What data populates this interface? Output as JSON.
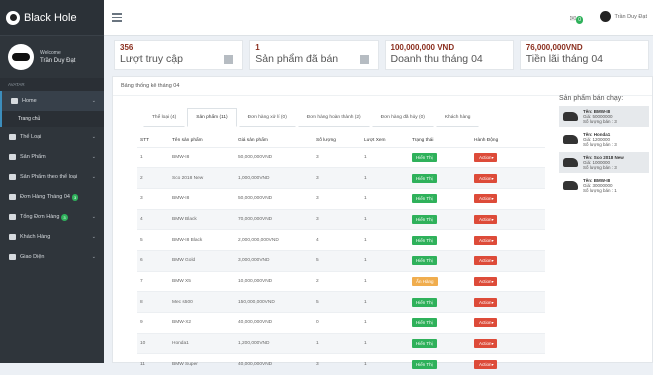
{
  "app": {
    "title": "Black Hole"
  },
  "profile": {
    "welcome": "Welcome",
    "name": "Trần Duy Đạt"
  },
  "sidebar": {
    "section": "AVATAR",
    "items": [
      {
        "label": "Home",
        "active": true
      },
      {
        "label": "Trang chủ",
        "sub": true
      },
      {
        "label": "Thể Loại"
      },
      {
        "label": "Sản Phẩm"
      },
      {
        "label": "Sản Phẩm theo thể loại"
      },
      {
        "label": "Đơn Hàng Tháng 04",
        "badge": "3"
      },
      {
        "label": "Tổng Đơn Hàng",
        "badge": "3"
      },
      {
        "label": "Khách Hàng"
      },
      {
        "label": "Giao Diện"
      }
    ]
  },
  "topbar": {
    "mail_badge": "0",
    "user": "Trần Duy Đạt"
  },
  "stats": [
    {
      "value": "356",
      "label": "Lượt truy cập"
    },
    {
      "value": "1",
      "label": "Sản phẩm đã bán"
    },
    {
      "value": "100,000,000 VND",
      "label": "Doanh thu tháng 04"
    },
    {
      "value": "76,000,000VND",
      "label": "Tiền lãi tháng 04"
    }
  ],
  "panel": {
    "title": "Bảng thống kê tháng 04"
  },
  "tabs": [
    "Thể loại (4)",
    "Sản phẩm (11)",
    "Đơn hàng xử lí (0)",
    "Đơn hàng hoàn thành (2)",
    "Đơn hàng đã hủy (0)",
    "Khách hàng"
  ],
  "table": {
    "headers": [
      "STT",
      "Tên sản phẩm",
      "Giá sản phẩm",
      "Số lượng",
      "Lượt Xem",
      "Trạng thái",
      "Hành Động"
    ],
    "status_label": "Hiển Thị",
    "hidden_label": "Ẩn Hàng",
    "action_label": "Action",
    "rows": [
      [
        "1",
        "BMW-I8",
        "50,000,000VND",
        "3",
        "1",
        "Hiển Thị"
      ],
      [
        "2",
        "Sco 2018 New",
        "1,000,000VND",
        "3",
        "1",
        "Hiển Thị"
      ],
      [
        "3",
        "BMW-I8",
        "50,000,000VND",
        "3",
        "1",
        "Hiển Thị"
      ],
      [
        "4",
        "BMW Black",
        "70,000,000VND",
        "3",
        "1",
        "Hiển Thị"
      ],
      [
        "5",
        "BMW-I8 Black",
        "2,000,000,000VND",
        "4",
        "1",
        "Hiển Thị"
      ],
      [
        "6",
        "BMW Gold",
        "3,000,000VND",
        "5",
        "1",
        "Hiển Thị"
      ],
      [
        "7",
        "BMW X5",
        "10,000,000VND",
        "2",
        "1",
        "Ẩn Hàng"
      ],
      [
        "8",
        "Mec s500",
        "150,000,000VND",
        "5",
        "1",
        "Hiển Thị"
      ],
      [
        "9",
        "BMW-X2",
        "40,000,000VND",
        "0",
        "1",
        "Hiển Thị"
      ],
      [
        "10",
        "Honda1",
        "1,200,000VND",
        "1",
        "1",
        "Hiển Thị"
      ],
      [
        "11",
        "BMW Super",
        "40,000,000VND",
        "3",
        "1",
        "Hiển Thị"
      ]
    ]
  },
  "bestsellers": {
    "title": "Sản phẩm bán chạy:",
    "items": [
      {
        "name": "Tên: BMW-I8",
        "price": "Giá: 50000000",
        "sold": "Số lượng bán : 3"
      },
      {
        "name": "Tên: Honda1",
        "price": "Giá: 1200000",
        "sold": "Số lượng bán : 3"
      },
      {
        "name": "Tên: Sco 2018 New",
        "price": "Giá: 1000000",
        "sold": "Số lượng bán : 3"
      },
      {
        "name": "Tên: BMW-I8",
        "price": "Giá: 30000000",
        "sold": "Số lượng bán : 1"
      }
    ]
  }
}
